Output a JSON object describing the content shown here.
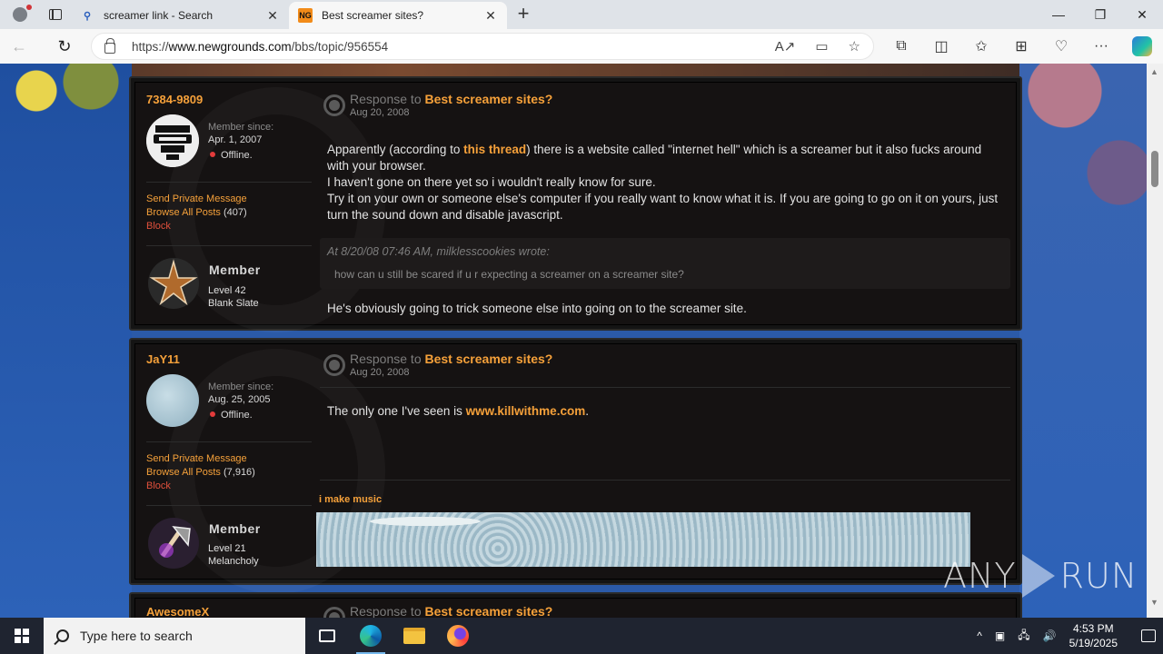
{
  "browser": {
    "tabs": [
      {
        "title": "screamer link - Search",
        "favicon": "search-icon"
      },
      {
        "title": "Best screamer sites?",
        "favicon": "ng-icon"
      }
    ],
    "url_prefix": "https://",
    "url_domain": "www.newgrounds.com",
    "url_path": "/bbs/topic/956554"
  },
  "posts": [
    {
      "username": "7384-9809",
      "member_since_label": "Member since:",
      "member_since": "Apr. 1, 2007",
      "status": "Offline.",
      "send_pm": "Send Private Message",
      "browse_posts": "Browse All Posts",
      "post_count": "(407)",
      "block": "Block",
      "rank": "Member",
      "level": "Level 42",
      "title": "Blank Slate",
      "response_to": "Response to",
      "topic": "Best screamer sites?",
      "date": "Aug 20, 2008",
      "body_line1_a": "Apparently (according to ",
      "body_link": "this thread",
      "body_line1_b": ") there is a website called \"internet hell\" which is a screamer but it also fucks around with your browser.",
      "body_line2": "I haven't gone on there yet so i wouldn't really know for sure.",
      "body_line3": "Try it on your own or someone else's computer if you really want to know what it is. If you are going to go on it on yours, just turn the sound down and disable javascript.",
      "quote_head": "At 8/20/08 07:46 AM, milklesscookies wrote:",
      "quote_text": "how can u still be scared if u r expecting a screamer on a screamer site?",
      "body_after": "He's obviously going to trick someone else into going on to the screamer site."
    },
    {
      "username": "JaY11",
      "member_since_label": "Member since:",
      "member_since": "Aug. 25, 2005",
      "status": "Offline.",
      "send_pm": "Send Private Message",
      "browse_posts": "Browse All Posts",
      "post_count": "(7,916)",
      "block": "Block",
      "rank": "Member",
      "level": "Level 21",
      "title": "Melancholy",
      "response_to": "Response to",
      "topic": "Best screamer sites?",
      "date": "Aug 20, 2008",
      "body_a": "The only one I've seen is ",
      "body_link": "www.killwithme.com",
      "body_b": ".",
      "signature": "i make music"
    },
    {
      "username": "AwesomeX",
      "response_to": "Response to",
      "topic": "Best screamer sites?"
    }
  ],
  "watermark": "ANY RUN",
  "taskbar": {
    "search_placeholder": "Type here to search",
    "time": "4:53 PM",
    "date": "5/19/2025"
  }
}
